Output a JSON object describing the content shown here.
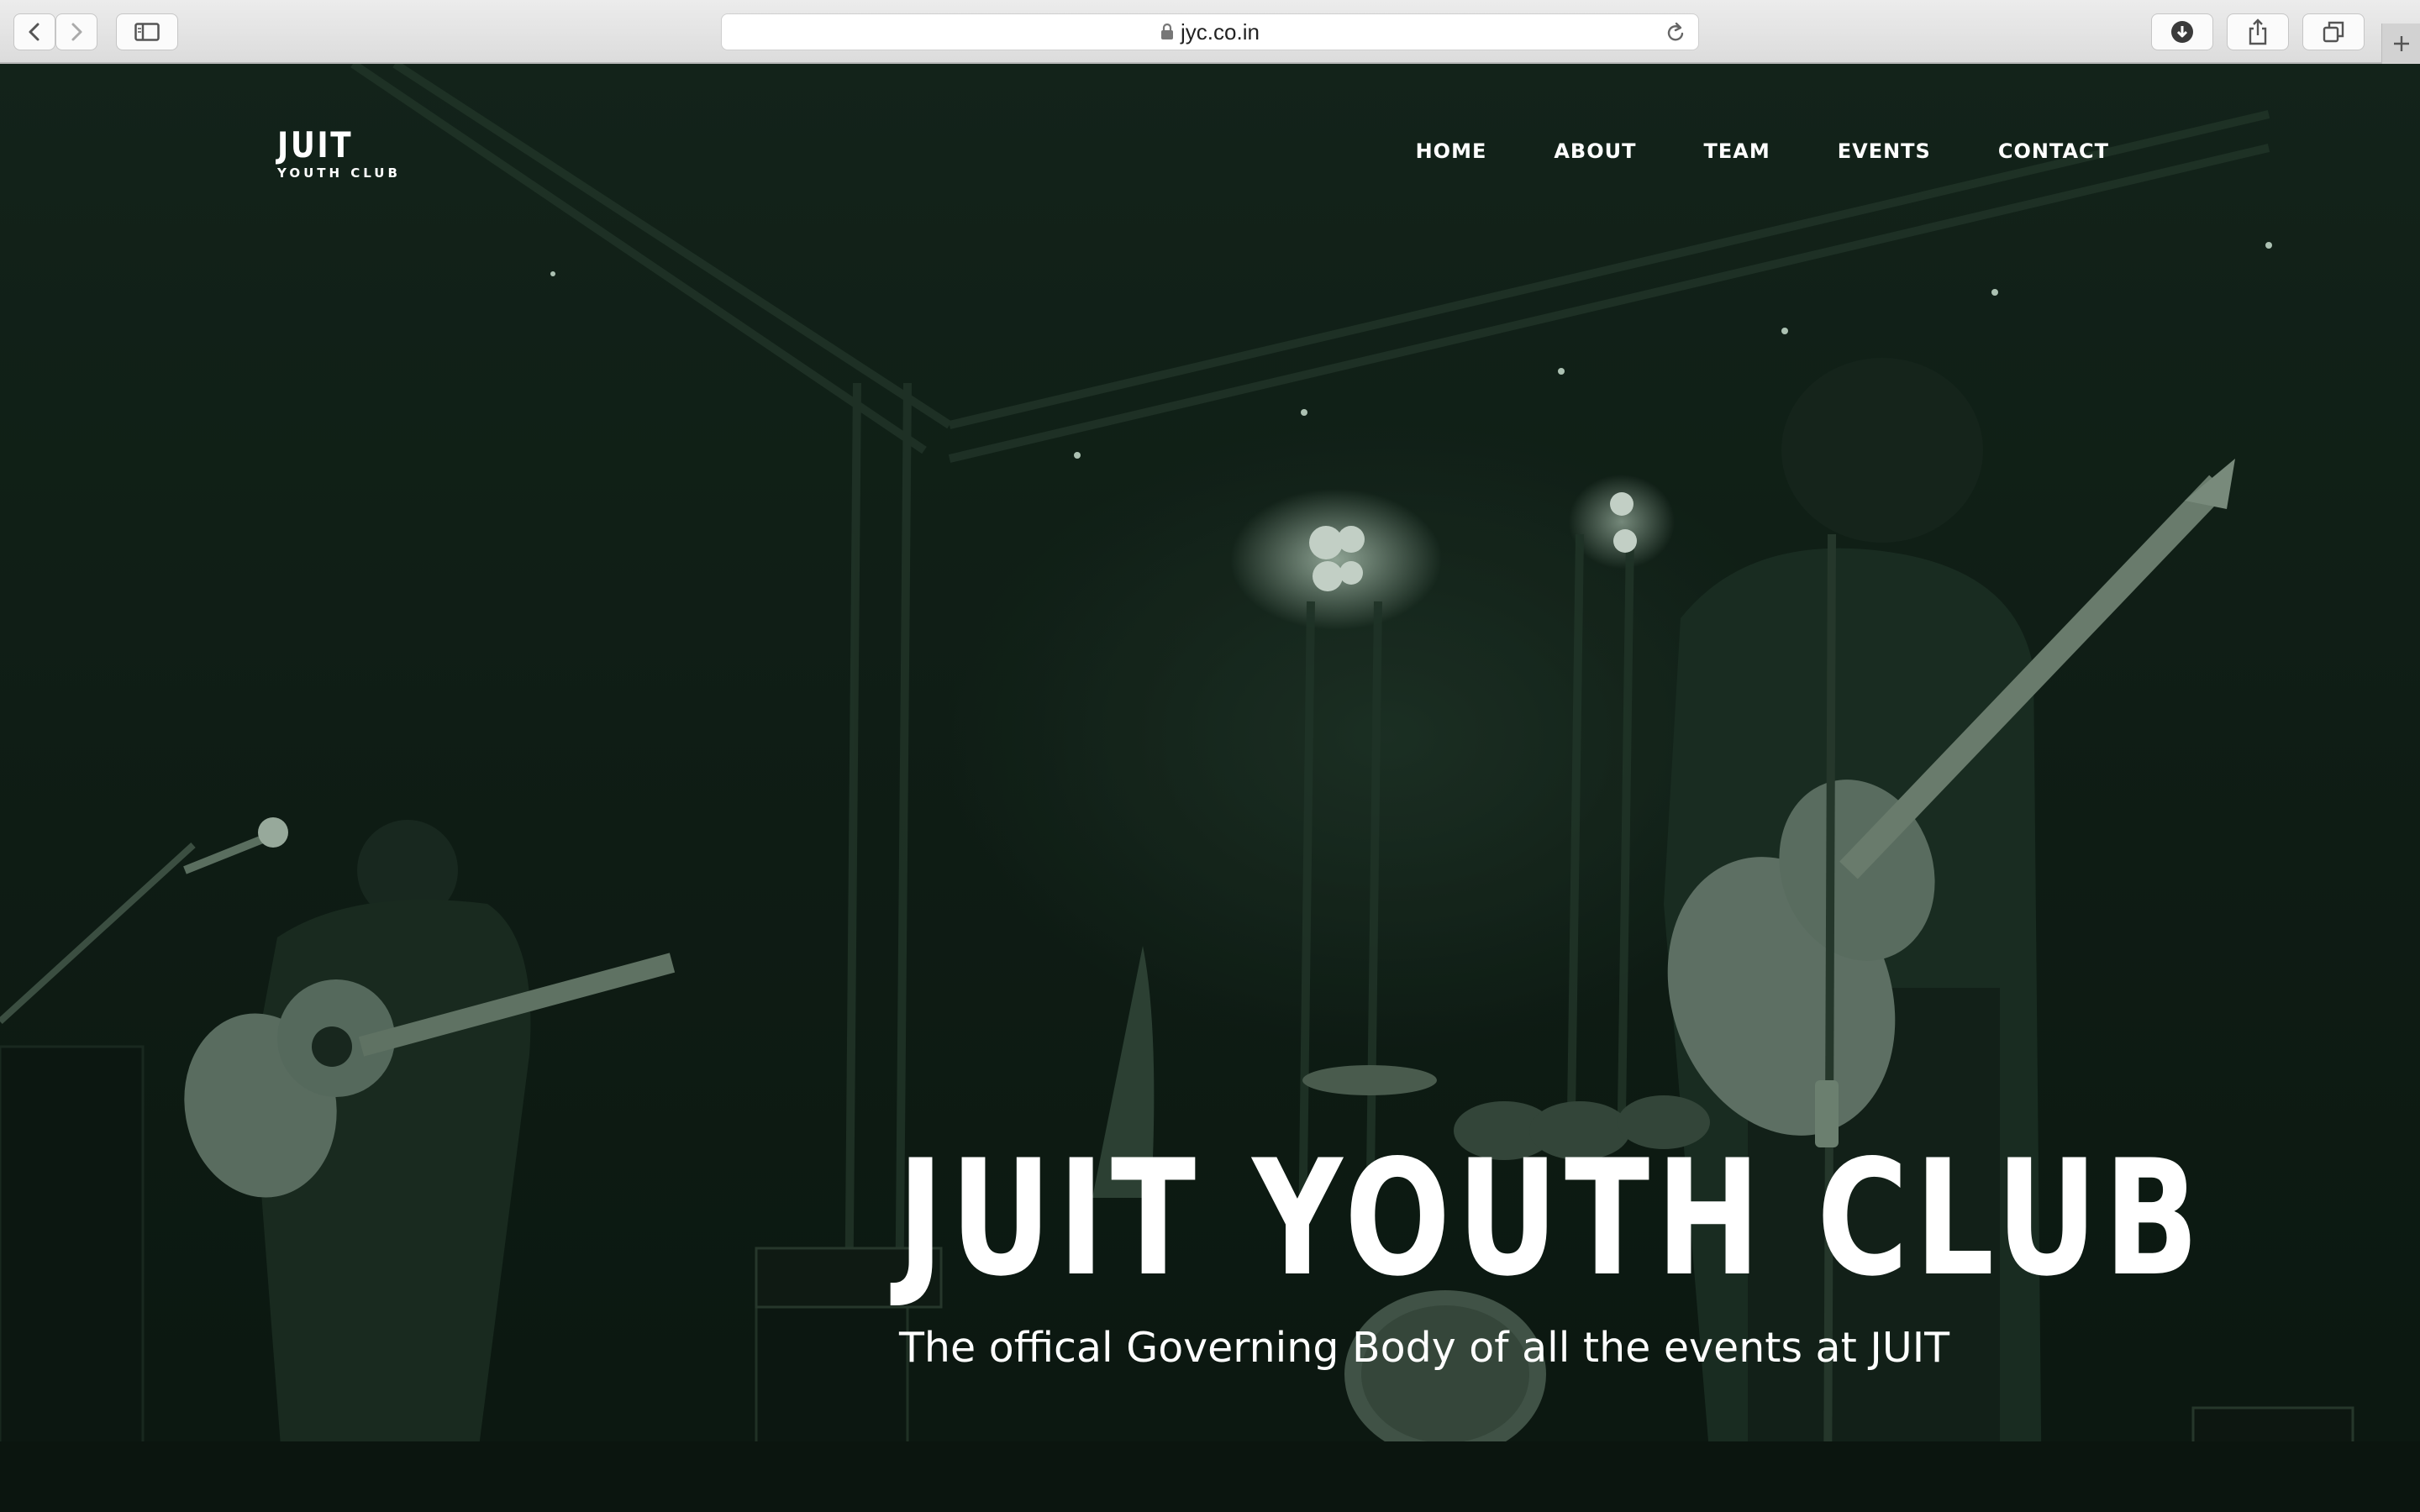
{
  "browser": {
    "url": "jyc.co.in",
    "icons": {
      "back": "chevron-left-icon",
      "forward": "chevron-right-icon",
      "sidebar": "sidebar-icon",
      "lock": "lock-icon",
      "reload": "reload-icon",
      "downloads": "download-icon",
      "share": "share-icon",
      "tabs": "tabs-overview-icon",
      "new_tab": "plus-icon"
    }
  },
  "site": {
    "logo": {
      "main": "JUIT",
      "sub": "YOUTH CLUB"
    },
    "nav": [
      {
        "label": "HOME"
      },
      {
        "label": "ABOUT"
      },
      {
        "label": "TEAM"
      },
      {
        "label": "EVENTS"
      },
      {
        "label": "CONTACT"
      }
    ],
    "hero": {
      "title": "JUIT YOUTH CLUB",
      "subtitle": "The offical Governing Body of all the events at JUIT",
      "overlay_color": "#0f1e15"
    }
  }
}
